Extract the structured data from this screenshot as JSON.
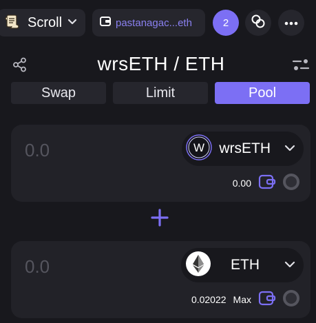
{
  "topbar": {
    "network": {
      "label": "Scroll",
      "icon": "scroll-logo-icon"
    },
    "wallet": {
      "address": "pastanagac...eth",
      "icon": "wallet-icon"
    },
    "notifications": {
      "count": "2"
    },
    "link_button_icon": "link-icon",
    "more_button_icon": "more-dots-icon"
  },
  "header": {
    "title": "wrsETH / ETH",
    "share_icon": "share-icon",
    "settings_icon": "sliders-icon"
  },
  "tabs": [
    {
      "label": "Swap",
      "active": false
    },
    {
      "label": "Limit",
      "active": false
    },
    {
      "label": "Pool",
      "active": true
    }
  ],
  "token_a": {
    "amount_placeholder": "0.0",
    "symbol": "wrsETH",
    "logo_letter": "W",
    "balance": "0.00"
  },
  "token_b": {
    "amount_placeholder": "0.0",
    "symbol": "ETH",
    "balance": "0.02022",
    "max_label": "Max"
  },
  "colors": {
    "background": "#18181d",
    "card": "#222228",
    "accent": "#7c6ff4"
  }
}
